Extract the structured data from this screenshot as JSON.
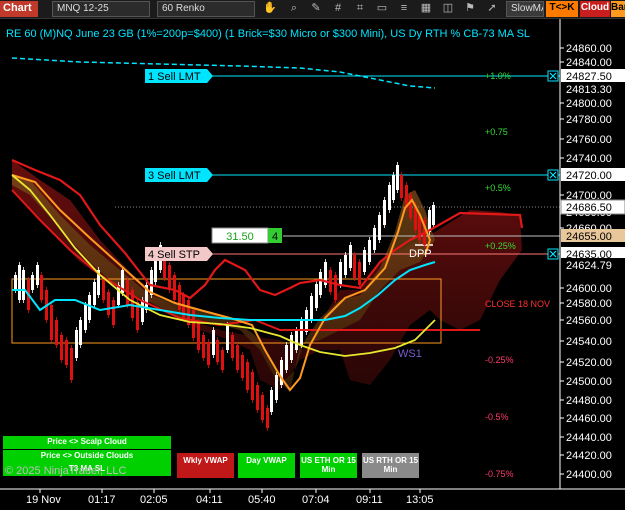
{
  "toolbar": {
    "title": "Chart",
    "instrument": "MNQ 12-25",
    "bar_type": "60 Renko",
    "indicator": "SlowMA",
    "tc_label": "T<>K",
    "cloud_label": "Cloud",
    "bar_label": "Bar",
    "icons": [
      "chevron-down-icon",
      "hand-icon",
      "search-icon",
      "pencil-icon",
      "hash-icon",
      "chevron-down-icon",
      "brackets-icon",
      "chevron-down-icon",
      "rectangle-icon",
      "chevron-down-icon",
      "list-icon",
      "grid-icon",
      "chart-icon",
      "gear-icon",
      "flag-icon",
      "chevron-down-icon",
      "rocket-icon"
    ]
  },
  "chart_header": "RE 60 (M)NQ June 23 GB (1%=200p=$400) (1 Brick=$30 Micro or $300 Mini), US Dy RTH % CB-73 MA SL",
  "price_axis": {
    "ticks": [
      "24860.00",
      "24840.00",
      "24800.00",
      "24780.00",
      "24760.00",
      "24740.00",
      "24700.00",
      "24680.00",
      "24660.00",
      "24600.00",
      "24580.00",
      "24560.00",
      "24540.00",
      "24520.00",
      "24500.00",
      "24480.00",
      "24460.00",
      "24440.00",
      "24420.00",
      "24400.00"
    ],
    "current_price": "24686.50",
    "levels": [
      {
        "price": "24827.50",
        "bg": "#ffffff",
        "fg": "#000000"
      },
      {
        "price": "24813.30",
        "bg": "#000000",
        "fg": "#ffffff"
      },
      {
        "price": "24720.00",
        "bg": "#ffffff",
        "fg": "#000000"
      },
      {
        "price": "24655.00",
        "bg": "#e8c79a",
        "fg": "#000000"
      },
      {
        "price": "24635.00",
        "bg": "#ffffff",
        "fg": "#000000"
      },
      {
        "price": "24624.79",
        "bg": "#000000",
        "fg": "#ffffff"
      }
    ]
  },
  "time_axis": {
    "ticks": [
      "19 Nov",
      "01:17",
      "02:05",
      "04:11",
      "05:40",
      "07:04",
      "09:11",
      "13:05"
    ]
  },
  "orders": [
    {
      "label": "1 Sell LMT"
    },
    {
      "label": "3 Sell LMT"
    },
    {
      "label": "4 Sell STP"
    }
  ],
  "position": {
    "pnl": "31.50",
    "qty": "4"
  },
  "pct_labels": [
    {
      "text": "+1.0%",
      "color": "#33dd33"
    },
    {
      "text": "+0.75",
      "color": "#33dd33"
    },
    {
      "text": "+0.5%",
      "color": "#33dd33"
    },
    {
      "text": "+0.25%",
      "color": "#33dd33"
    },
    {
      "text": "-0.25%",
      "color": "#ff3b6b"
    },
    {
      "text": "-0.5%",
      "color": "#ff3b6b"
    },
    {
      "text": "-0.75%",
      "color": "#ff3b6b"
    }
  ],
  "close_label": "CLOSE 18 NOV",
  "dpp_label": "DPP",
  "ws1_label": "WS1",
  "copyright": "© 2025 NinjaTrader, LLC",
  "panel_buttons": {
    "scalp": "Price <> Scalp Cloud",
    "outside": "Price <> Outside Clouds",
    "t3": "T3 MA SL",
    "wkly": "Wkly VWAP",
    "day": "Day VWAP",
    "eth": "US ETH OR 15 Min",
    "rth": "US RTH OR 15 Min"
  },
  "colors": {
    "up": "#ffffff",
    "down": "#e01010",
    "cyan": "#00e5ff",
    "orange": "#ff9a1f",
    "yellow": "#e8e830",
    "green": "#00e000",
    "red_btn": "#c01818",
    "gray_btn": "#8a8a8a",
    "axis_bg": "#000000"
  }
}
